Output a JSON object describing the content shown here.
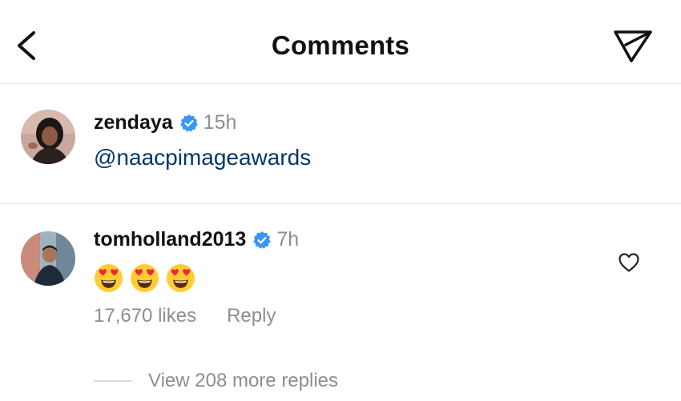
{
  "header": {
    "title": "Comments",
    "back_icon": "chevron-left-icon",
    "share_icon": "paper-plane-icon"
  },
  "comments": [
    {
      "username": "zendaya",
      "verified": true,
      "time": "15h",
      "text": "@naacpimageawards",
      "avatar_icon": "avatar-photo"
    },
    {
      "username": "tomholland2013",
      "verified": true,
      "time": "7h",
      "emojis": [
        "😍",
        "😍",
        "😍"
      ],
      "likes": "17,670 likes",
      "reply_label": "Reply",
      "view_replies": "View 208 more replies",
      "avatar_icon": "avatar-photo",
      "like_icon": "heart-outline-icon"
    }
  ],
  "colors": {
    "verified_blue": "#3897f0",
    "mention": "#00376b",
    "secondary_text": "#8e8e8e",
    "divider": "#e3e3e3"
  }
}
